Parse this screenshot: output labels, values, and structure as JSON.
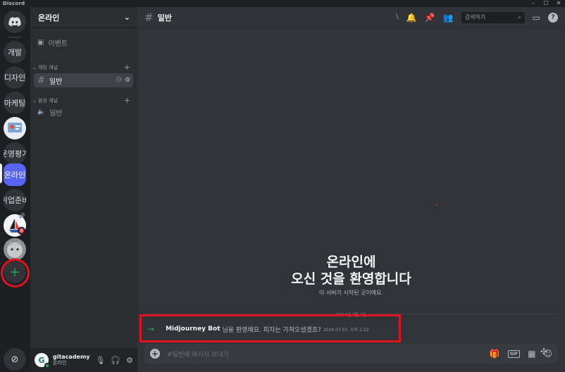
{
  "app": {
    "brand": "Discord",
    "window_controls": [
      "–",
      "☐",
      "✕"
    ]
  },
  "rail": {
    "servers": [
      {
        "label": "개발",
        "type": "text"
      },
      {
        "label": "디자인",
        "type": "text"
      },
      {
        "label": "마케팅",
        "type": "text"
      },
      {
        "label": "",
        "type": "image"
      },
      {
        "label": "운영평가",
        "type": "text"
      },
      {
        "label": "온라인",
        "type": "text",
        "active": true
      },
      {
        "label": "취업준비",
        "type": "text"
      },
      {
        "label": "9",
        "type": "image-badge"
      },
      {
        "label": "",
        "type": "image-cat"
      }
    ],
    "add_label": "+",
    "discover_label": "⊘"
  },
  "sidebar": {
    "server_name": "온라인",
    "events_label": "이벤트",
    "text_category": "채팅 채널",
    "voice_category": "음성 채널",
    "text_channel": "일반",
    "voice_channel": "일반"
  },
  "user": {
    "name": "gitacademy",
    "status": "온라인",
    "initial": "G"
  },
  "header": {
    "channel": "일반",
    "search_placeholder": "검색하기"
  },
  "welcome": {
    "line1": "온라인에",
    "line2": "오신 것을 환영합니다",
    "subtitle": "이 서버가 시작된 곳이에요."
  },
  "date_divider": "2024년 7월 3일",
  "message": {
    "author": "Midjourney Bot",
    "text": "님을 환영해요. 피자는 가져오셨겠죠?",
    "time": "2024.07.03. 오후 2:22"
  },
  "composer": {
    "placeholder": "#일반에 메시지 보내기",
    "gif_label": "GIF"
  },
  "colors": {
    "accent": "#5865f2",
    "online": "#23a55a",
    "highlight": "#e0141c"
  }
}
